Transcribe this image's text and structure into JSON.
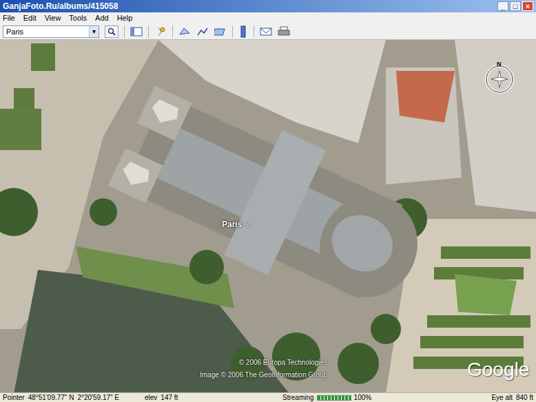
{
  "window": {
    "title": "GanjaFoto.Ru/albums/415058",
    "controls": [
      "_",
      "□",
      "×"
    ]
  },
  "menu": [
    "File",
    "Edit",
    "View",
    "Tools",
    "Add",
    "Help"
  ],
  "toolbar": {
    "search_value": "Paris",
    "dropdown_arrow": "▾"
  },
  "map": {
    "place_label": "Paris",
    "place_icon": "☆",
    "compass_label": "N",
    "copyrights": [
      "© 2006 Europa Technologies",
      "Image © 2006 The GeoInformation Group"
    ],
    "logo": "Google"
  },
  "status_bar": {
    "pointer_label": "Pointer",
    "lat": "48°51'09.77\" N",
    "lon": "2°20'59.17\" E",
    "elev_label": "elev",
    "elev": "147 ft",
    "streaming_label": "Streaming",
    "streaming_level": 1,
    "streaming_percent": "100%",
    "eye_alt_label": "Eye alt",
    "eye_alt": "840 ft"
  }
}
